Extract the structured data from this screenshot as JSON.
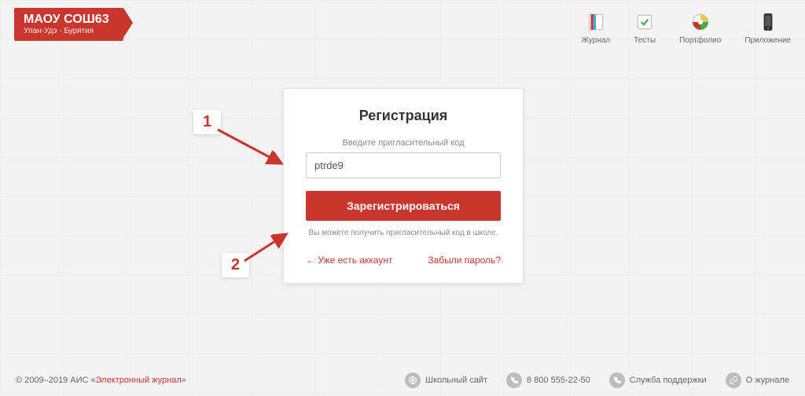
{
  "brand": {
    "title": "МАОУ СОШ63",
    "subtitle": "Улан-Удэ · Бурятия"
  },
  "topnav": {
    "journal": "Журнал",
    "tests": "Тесты",
    "portfolio": "Портфолио",
    "app": "Приложение"
  },
  "panel": {
    "heading": "Регистрация",
    "hint": "Введите пригласительный код",
    "code_value": "ptrde9",
    "submit": "Зарегистрироваться",
    "note": "Вы можете получить пригласительный код в школе.",
    "link_have_account": "← Уже есть аккаунт",
    "link_forgot": "Забыли пароль?"
  },
  "annotations": {
    "num1": "1",
    "num2": "2"
  },
  "footer": {
    "copyright_prefix": "© 2009–2019 АИС «",
    "copyright_link": "Электронный журнал",
    "copyright_suffix": "»",
    "school_site": "Школьный сайт",
    "phone": "8 800 555-22-50",
    "support": "Служба поддержки",
    "about": "О журнале"
  },
  "colors": {
    "accent": "#c9362e"
  }
}
